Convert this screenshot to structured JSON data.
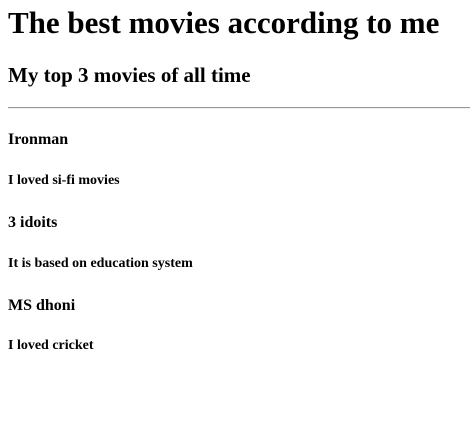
{
  "page": {
    "heading": "The best movies according to me",
    "subheading": "My top 3 movies of all time"
  },
  "movies": [
    {
      "title": "Ironman",
      "description": "I loved si-fi movies"
    },
    {
      "title": "3 idoits",
      "description": "It is based on education system"
    },
    {
      "title": "MS dhoni",
      "description": "I loved cricket"
    }
  ],
  "colors": {
    "background": "#ffffff",
    "text": "#000000",
    "divider": "#9a9a9a"
  }
}
